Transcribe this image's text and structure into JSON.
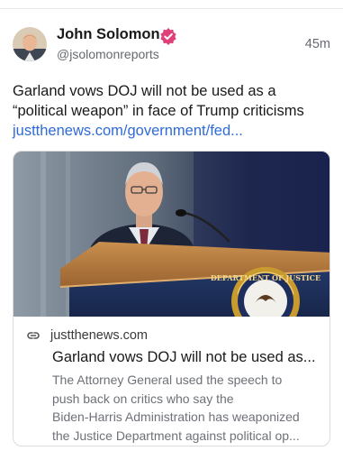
{
  "author": {
    "display_name": "John Solomon",
    "handle": "@jsolomonreports",
    "verified_icon": "verified-badge-icon",
    "verified_color": "#e0407a"
  },
  "post": {
    "timestamp": "45m",
    "text_lines": [
      "Garland vows DOJ will not be used as a",
      "“political weapon” in face of Trump criticisms"
    ],
    "link_text": "justthenews.com/government/fed..."
  },
  "link_card": {
    "icon": "link-icon",
    "domain": "justthenews.com",
    "title": "Garland vows DOJ will not be used as...",
    "description_lines": [
      "The Attorney General used the speech to",
      "push back on critics who say the",
      "Biden-Harris Administration has weaponized",
      "the Justice Department against political op..."
    ],
    "seal_text": "DEPARTMENT OF JUSTICE"
  },
  "colors": {
    "link": "#2f6bd6",
    "text": "#1a1a1a",
    "muted": "#666a70"
  }
}
